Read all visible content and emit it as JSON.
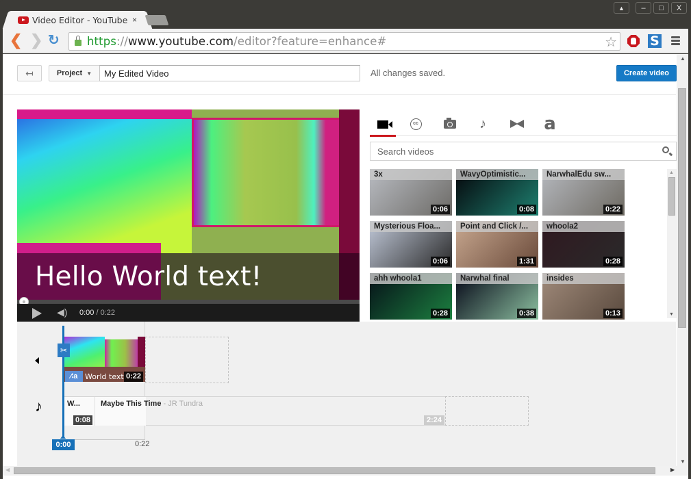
{
  "browser": {
    "tab_title": "Video Editor - YouTube",
    "tab_close": "×",
    "url": {
      "scheme": "https",
      "separator": "://",
      "host": "www.youtube.com",
      "path": "/editor?feature=enhance#"
    },
    "window_buttons": {
      "user": "👤",
      "minimize": "–",
      "maximize": "□",
      "close": "X"
    },
    "star": "☆",
    "extension_s": "S"
  },
  "topbar": {
    "back_icon": "↤",
    "project_label": "Project",
    "project_caret": "▼",
    "title_value": "My Edited Video",
    "saved_status": "All changes saved.",
    "create_label": "Create video"
  },
  "preview": {
    "overlay_text": "Hello World text!",
    "current_time": "0:00",
    "duration_sep": " / ",
    "duration": "0:22",
    "progress": 0,
    "volume_icon": "◀)"
  },
  "panel": {
    "tabs": [
      {
        "name": "videos",
        "active": true
      },
      {
        "name": "captions",
        "label": "cc"
      },
      {
        "name": "photos"
      },
      {
        "name": "audio",
        "label": "♪"
      },
      {
        "name": "transitions"
      },
      {
        "name": "text",
        "label": "a"
      }
    ],
    "search_placeholder": "Search videos",
    "videos": [
      {
        "title": "3x",
        "duration": "0:06",
        "colors": [
          "#b9bcc2",
          "#6c6a66"
        ]
      },
      {
        "title": "WavyOptimistic...",
        "duration": "0:08",
        "colors": [
          "#05050a",
          "#1e8070"
        ]
      },
      {
        "title": "NarwhalEdu sw...",
        "duration": "0:22",
        "colors": [
          "#b5b8be",
          "#6e6a62"
        ]
      },
      {
        "title": "Mysterious Floa...",
        "duration": "0:06",
        "colors": [
          "#c0c8d8",
          "#2a2a2a"
        ]
      },
      {
        "title": "Point and Click /...",
        "duration": "1:31",
        "colors": [
          "#c8a890",
          "#6a4a3a"
        ]
      },
      {
        "title": "whoola2",
        "duration": "0:28",
        "colors": [
          "#301820",
          "#2a2a2a"
        ]
      },
      {
        "title": "ahh whoola1",
        "duration": "0:28",
        "colors": [
          "#061018",
          "#1c8040"
        ]
      },
      {
        "title": "Narwhal final",
        "duration": "0:38",
        "colors": [
          "#060818",
          "#8cc0a0"
        ]
      },
      {
        "title": "insides",
        "duration": "0:13",
        "colors": [
          "#a08a7a",
          "#5a4a3e"
        ]
      }
    ]
  },
  "timeline": {
    "video_clip": {
      "text_badge": "⁄∶a",
      "text": "World text!",
      "duration": "0:22"
    },
    "audio_clip1": {
      "name": "W...",
      "duration": "0:08"
    },
    "audio_clip2": {
      "song": "Maybe This Time",
      "artist": " - JR Tundra",
      "duration": "2:24"
    },
    "scissors": "✂",
    "playhead_time": "0:00",
    "end_time": "0:22"
  }
}
